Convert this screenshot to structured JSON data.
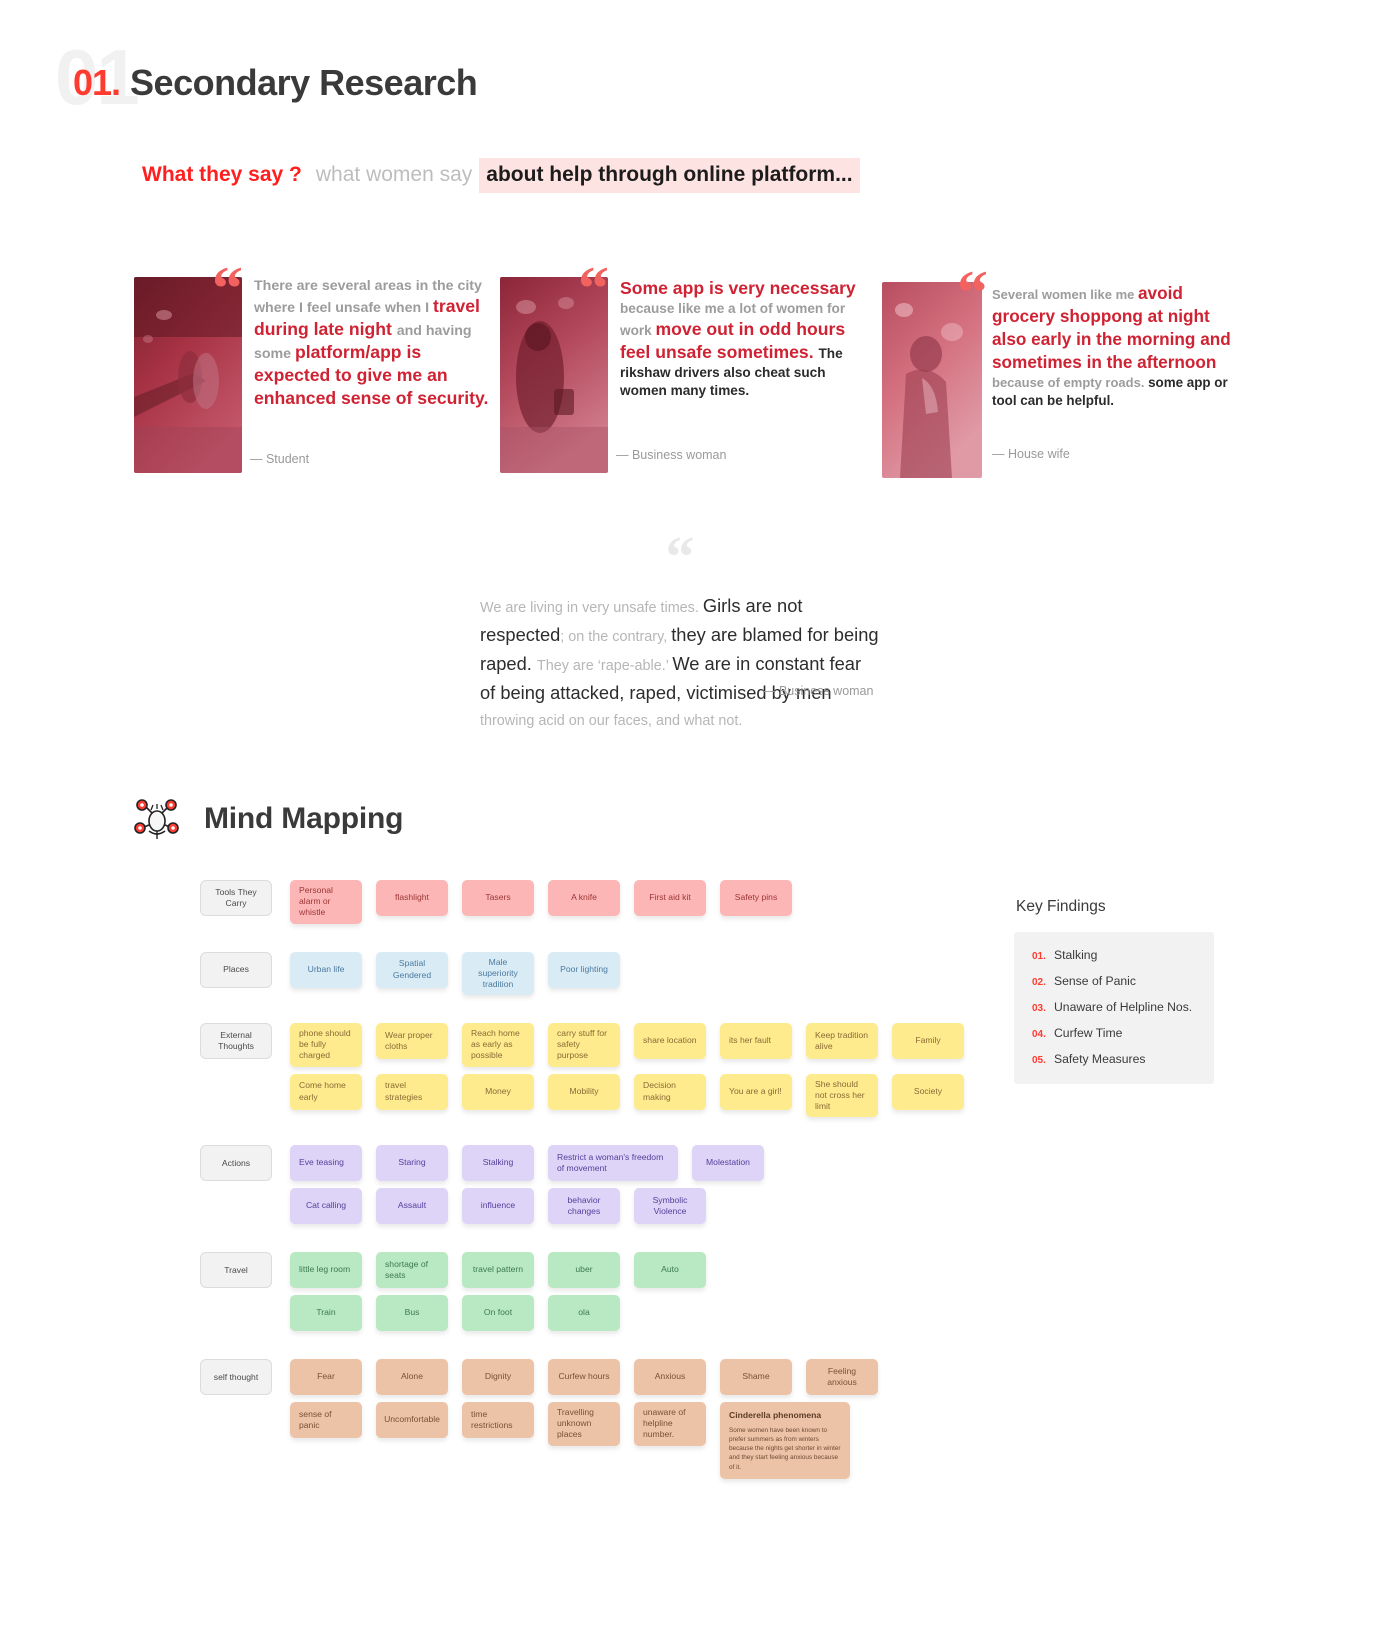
{
  "section": {
    "ghost_number": "01",
    "number": "01.",
    "title": "Secondary Research"
  },
  "what_they_say": {
    "red": "What they say ?",
    "grey": "what women say",
    "highlight": "about help through online platform..."
  },
  "quotes": [
    {
      "id": "quote-student",
      "mark": "“",
      "parts": [
        {
          "style": "g",
          "text": "There are several areas in the city where I feel unsafe when I "
        },
        {
          "style": "r",
          "text": "travel during late night "
        },
        {
          "style": "g",
          "text": "and having some "
        },
        {
          "style": "r",
          "text": "platform/app is expected to give me an enhanced sense of security."
        }
      ],
      "attribution": "— Student",
      "photo_alt": "night-street-photo"
    },
    {
      "id": "quote-business-woman",
      "mark": "“",
      "parts": [
        {
          "style": "r",
          "text": "Some app is very necessary "
        },
        {
          "style": "g",
          "text": "because like me a lot of women for work "
        },
        {
          "style": "r",
          "text": "move out in odd hours feel unsafe sometimes. "
        },
        {
          "style": "d",
          "text": "The rikshaw drivers also cheat such women many times."
        }
      ],
      "attribution": "— Business woman",
      "photo_alt": "woman-walking-market-photo"
    },
    {
      "id": "quote-house-wife",
      "mark": "“",
      "parts": [
        {
          "style": "g",
          "text": "Several women like me "
        },
        {
          "style": "r",
          "text": "avoid grocery shoppong at night also early in the morning and sometimes in the afternoon "
        },
        {
          "style": "g",
          "text": "because of empty roads. "
        },
        {
          "style": "d",
          "text": "some app or tool can be helpful."
        }
      ],
      "attribution": "— House wife",
      "photo_alt": "woman-portrait-photo"
    }
  ],
  "big_quote": {
    "mark": "“",
    "parts": [
      {
        "style": "g",
        "text": "We are living in very unsafe times. "
      },
      {
        "style": "d",
        "text": "Girls are not respected"
      },
      {
        "style": "g",
        "text": "; on the contrary, "
      },
      {
        "style": "d",
        "text": "they are blamed for being raped. "
      },
      {
        "style": "g",
        "text": "They are ‘rape-able.’ "
      },
      {
        "style": "d",
        "text": "We are in constant fear of being attacked, raped, victimised by men "
      },
      {
        "style": "g",
        "text": "throwing acid on our faces, and what not."
      }
    ],
    "attribution": "— Business woman"
  },
  "mind_mapping": {
    "title": "Mind Mapping",
    "icon": "mind-map-icon",
    "rows": [
      {
        "category": "Tools They Carry",
        "color": "pink",
        "lines": [
          [
            {
              "text": "Personal alarm or whistle",
              "w": "w-m"
            },
            {
              "text": "flashlight",
              "w": "w-m",
              "center": true
            },
            {
              "text": "Tasers",
              "w": "w-m",
              "center": true
            },
            {
              "text": "A knife",
              "w": "w-m",
              "center": true
            },
            {
              "text": "First aid kit",
              "w": "w-m",
              "center": true
            },
            {
              "text": "Safety pins",
              "w": "w-m",
              "center": true
            }
          ]
        ]
      },
      {
        "category": "Places",
        "color": "blue",
        "lines": [
          [
            {
              "text": "Urban life",
              "w": "w-m",
              "center": true
            },
            {
              "text": "Spatial Gendered",
              "w": "w-m",
              "center": true
            },
            {
              "text": "Male superiority tradition",
              "w": "w-m",
              "center": true
            },
            {
              "text": "Poor lighting",
              "w": "w-m",
              "center": true
            }
          ]
        ]
      },
      {
        "category": "External Thoughts",
        "color": "yellow",
        "lines": [
          [
            {
              "text": "phone should be fully charged",
              "w": "w-m"
            },
            {
              "text": "Wear proper cloths",
              "w": "w-m"
            },
            {
              "text": "Reach home as early as possible",
              "w": "w-m"
            },
            {
              "text": "carry stuff for safety purpose",
              "w": "w-m"
            },
            {
              "text": "share location",
              "w": "w-m"
            },
            {
              "text": "its her fault",
              "w": "w-m"
            },
            {
              "text": "Keep tradition alive",
              "w": "w-m"
            },
            {
              "text": "Family",
              "w": "w-m",
              "center": true
            }
          ],
          [
            {
              "text": "Come home early",
              "w": "w-m"
            },
            {
              "text": "travel strategies",
              "w": "w-m"
            },
            {
              "text": "Money",
              "w": "w-m",
              "center": true
            },
            {
              "text": "Mobility",
              "w": "w-m",
              "center": true
            },
            {
              "text": "Decision making",
              "w": "w-m"
            },
            {
              "text": "You are a girl!",
              "w": "w-m"
            },
            {
              "text": "She should not cross her limit",
              "w": "w-m"
            },
            {
              "text": "Society",
              "w": "w-m",
              "center": true
            }
          ]
        ]
      },
      {
        "category": "Actions",
        "color": "purple",
        "lines": [
          [
            {
              "text": "Eve teasing",
              "w": "w-m"
            },
            {
              "text": "Staring",
              "w": "w-m",
              "center": true
            },
            {
              "text": "Stalking",
              "w": "w-m",
              "center": true
            },
            {
              "text": "Restrict a woman's freedom of movement",
              "w": "w-xl"
            },
            {
              "text": "Molestation",
              "w": "w-m",
              "center": true
            }
          ],
          [
            {
              "text": "Cat calling",
              "w": "w-m",
              "center": true
            },
            {
              "text": "Assault",
              "w": "w-m",
              "center": true
            },
            {
              "text": "influence",
              "w": "w-m",
              "center": true
            },
            {
              "text": "behavior changes",
              "w": "w-m",
              "center": true
            },
            {
              "text": "Symbolic Violence",
              "w": "w-m",
              "center": true
            }
          ]
        ]
      },
      {
        "category": "Travel",
        "color": "green",
        "lines": [
          [
            {
              "text": "little leg room",
              "w": "w-m"
            },
            {
              "text": "shortage of seats",
              "w": "w-m"
            },
            {
              "text": "travel pattern",
              "w": "w-m",
              "center": true
            },
            {
              "text": "uber",
              "w": "w-m",
              "center": true
            },
            {
              "text": "Auto",
              "w": "w-m",
              "center": true
            }
          ],
          [
            {
              "text": "Train",
              "w": "w-m",
              "center": true
            },
            {
              "text": "Bus",
              "w": "w-m",
              "center": true
            },
            {
              "text": "On foot",
              "w": "w-m",
              "center": true
            },
            {
              "text": "ola",
              "w": "w-m",
              "center": true
            }
          ]
        ]
      },
      {
        "category": "self thought",
        "color": "peach",
        "lines": [
          [
            {
              "text": "Fear",
              "w": "w-m",
              "center": true
            },
            {
              "text": "Alone",
              "w": "w-m",
              "center": true
            },
            {
              "text": "Dignity",
              "w": "w-m",
              "center": true
            },
            {
              "text": "Curfew hours",
              "w": "w-m",
              "center": true
            },
            {
              "text": "Anxious",
              "w": "w-m",
              "center": true
            },
            {
              "text": "Shame",
              "w": "w-m",
              "center": true
            },
            {
              "text": "Feeling anxious",
              "w": "w-m",
              "center": true
            }
          ],
          [
            {
              "text": "sense of panic",
              "w": "w-m"
            },
            {
              "text": "Uncomfortable",
              "w": "w-m",
              "center": true
            },
            {
              "text": "time restrictions",
              "w": "w-m"
            },
            {
              "text": "Travelling unknown places",
              "w": "w-m"
            },
            {
              "text": "unaware of helpline number.",
              "w": "w-m"
            }
          ]
        ]
      }
    ],
    "long_note": {
      "title": "Cinderella phenomena",
      "body": "Some women have been known to prefer summers as from winters because the nights get shorter in winter and they start feeling anxious because of it."
    }
  },
  "key_findings": {
    "title": "Key Findings",
    "items": [
      {
        "num": "01.",
        "label": "Stalking"
      },
      {
        "num": "02.",
        "label": "Sense of Panic"
      },
      {
        "num": "03.",
        "label": "Unaware of Helpline Nos."
      },
      {
        "num": "04.",
        "label": "Curfew Time"
      },
      {
        "num": "05.",
        "label": "Safety Measures"
      }
    ]
  },
  "colors": {
    "accent_red": "#ff3b30",
    "quote_red": "#cf2233",
    "highlight_bg": "#fde3e1"
  }
}
